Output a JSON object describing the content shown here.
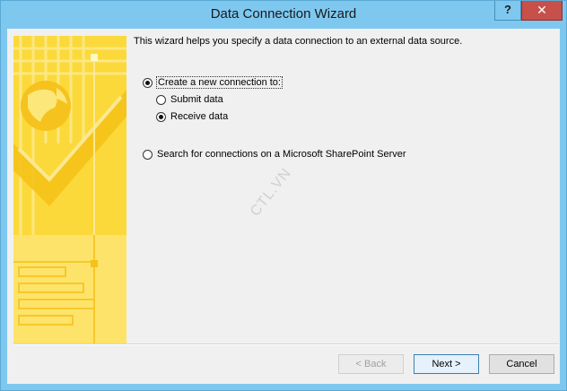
{
  "window": {
    "title": "Data Connection Wizard",
    "help_label": "?",
    "close_label": "✕",
    "titlebar_color": "#7ec8f0",
    "close_color": "#c7504a"
  },
  "main": {
    "intro": "This wizard helps you specify a data connection to an external data source.",
    "options": {
      "create_label": "Create a new connection to:",
      "create_selected": true,
      "submit_label": "Submit data",
      "submit_selected": false,
      "receive_label": "Receive data",
      "receive_selected": true,
      "search_label": "Search for connections on a Microsoft SharePoint Server",
      "search_selected": false
    }
  },
  "watermark": "CTL.VN",
  "buttons": {
    "back_label": "< Back",
    "next_label": "Next >",
    "cancel_label": "Cancel"
  },
  "banner": {
    "color": "#fbd93a",
    "icon": "globe-data-illustration"
  }
}
